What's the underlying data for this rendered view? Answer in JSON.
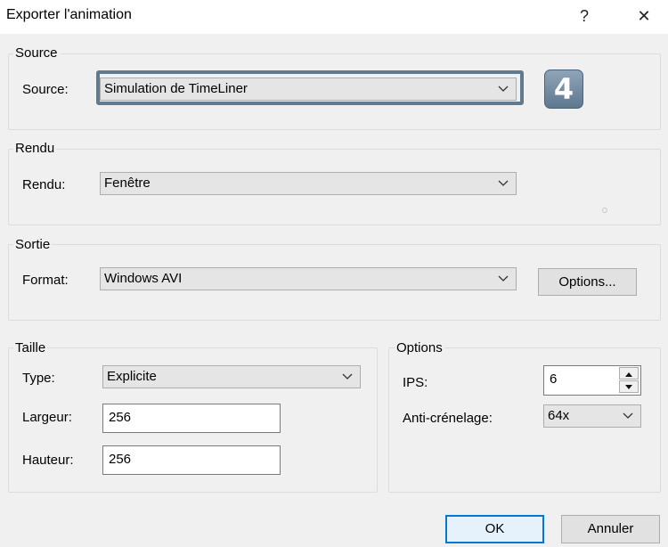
{
  "window": {
    "title": "Exporter l'animation",
    "help_label": "?",
    "close_label": "✕"
  },
  "source": {
    "group_label": "Source",
    "field_label": "Source:",
    "value": "Simulation de TimeLiner",
    "badge": "4"
  },
  "rendu": {
    "group_label": "Rendu",
    "field_label": "Rendu:",
    "value": "Fenêtre"
  },
  "sortie": {
    "group_label": "Sortie",
    "field_label": "Format:",
    "value": "Windows AVI",
    "options_button": "Options..."
  },
  "taille": {
    "group_label": "Taille",
    "type_label": "Type:",
    "type_value": "Explicite",
    "largeur_label": "Largeur:",
    "largeur_value": "256",
    "hauteur_label": "Hauteur:",
    "hauteur_value": "256"
  },
  "options": {
    "group_label": "Options",
    "ips_label": "IPS:",
    "ips_value": "6",
    "anti_label": "Anti-crénelage:",
    "anti_value": "64x"
  },
  "footer": {
    "ok_label": "OK",
    "cancel_label": "Annuler"
  },
  "colors": {
    "accent": "#0078d7",
    "focus_ring": "#617a8e",
    "badge": "#6e879e"
  },
  "icons": {
    "dropdown": "chevron-down-icon",
    "spin_up": "arrow-up-icon",
    "spin_down": "arrow-down-icon"
  }
}
